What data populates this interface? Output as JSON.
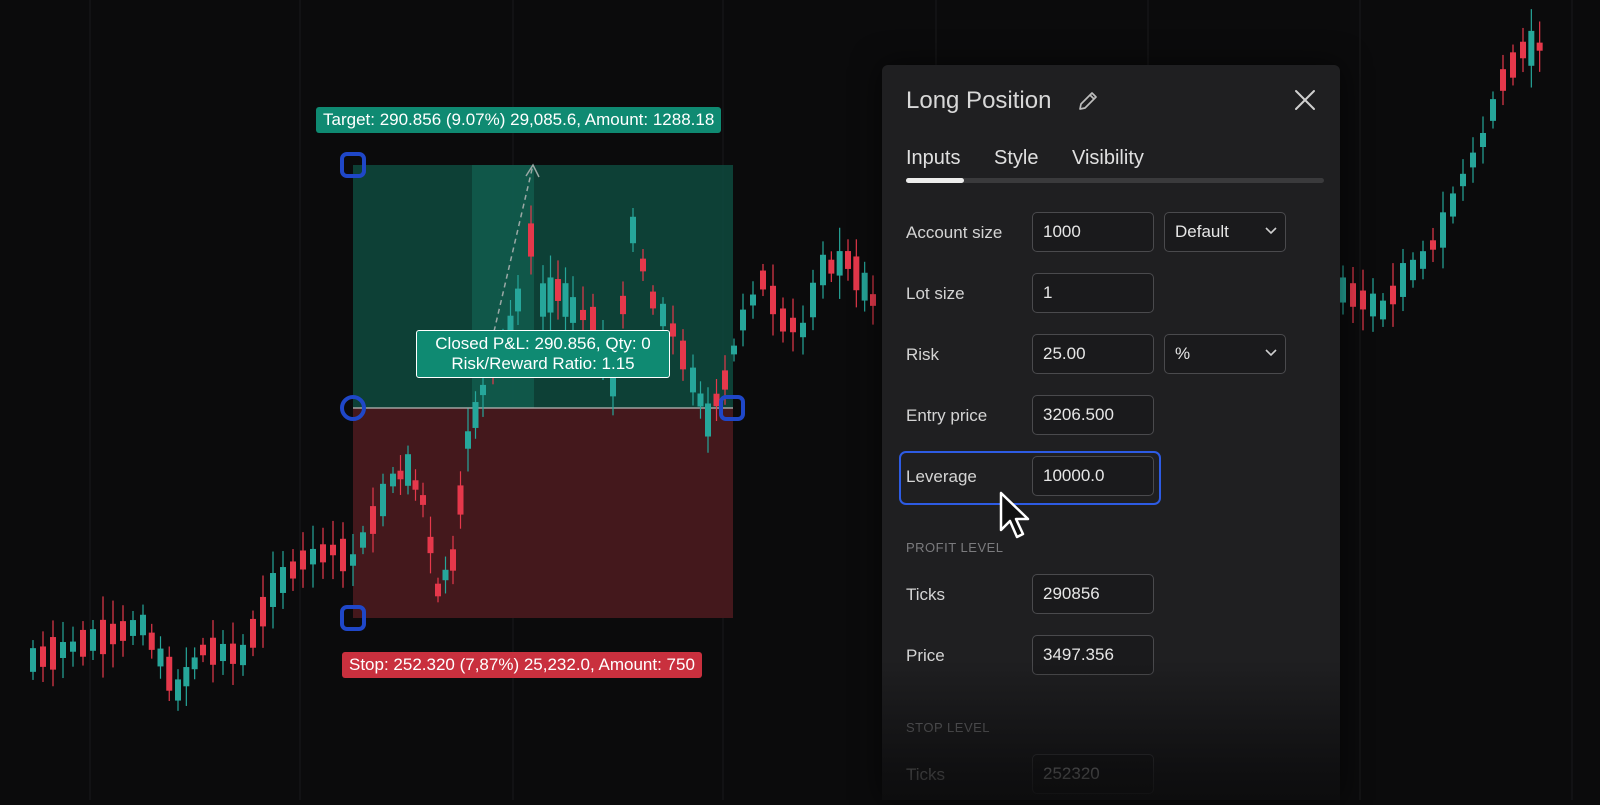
{
  "chart": {
    "colors": {
      "up": "#26a69a",
      "down": "#e5384b",
      "target_zone": "#0e4a3e",
      "stop_zone": "#4a1a1e",
      "handle": "#1f47c8",
      "background": "#0b0b0c"
    },
    "target_label": "Target: 290.856 (9.07%) 29,085.6, Amount: 1288.18",
    "stop_label": "Stop: 252.320 (7,87%) 25,232.0, Amount: 750",
    "pnl_line1": "Closed P&L: 290.856, Qty: 0",
    "pnl_line2": "Risk/Reward Ratio: 1.15"
  },
  "panel": {
    "title": "Long Position",
    "tabs": [
      {
        "label": "Inputs",
        "active": true
      },
      {
        "label": "Style",
        "active": false
      },
      {
        "label": "Visibility",
        "active": false
      }
    ],
    "inputs": {
      "account_size": {
        "label": "Account size",
        "value": "1000",
        "select": "Default"
      },
      "lot_size": {
        "label": "Lot size",
        "value": "1"
      },
      "risk": {
        "label": "Risk",
        "value": "25.00",
        "select": "%"
      },
      "entry_price": {
        "label": "Entry price",
        "value": "3206.500"
      },
      "leverage": {
        "label": "Leverage",
        "value": "10000.0"
      }
    },
    "profit_level": {
      "header": "PROFIT LEVEL",
      "ticks": {
        "label": "Ticks",
        "value": "290856"
      },
      "price": {
        "label": "Price",
        "value": "3497.356"
      }
    },
    "stop_level": {
      "header": "STOP LEVEL",
      "ticks": {
        "label": "Ticks",
        "value": "252320"
      }
    },
    "icons": {
      "edit": "pencil-icon",
      "close": "close-icon"
    },
    "accent": "#2d5be3"
  }
}
